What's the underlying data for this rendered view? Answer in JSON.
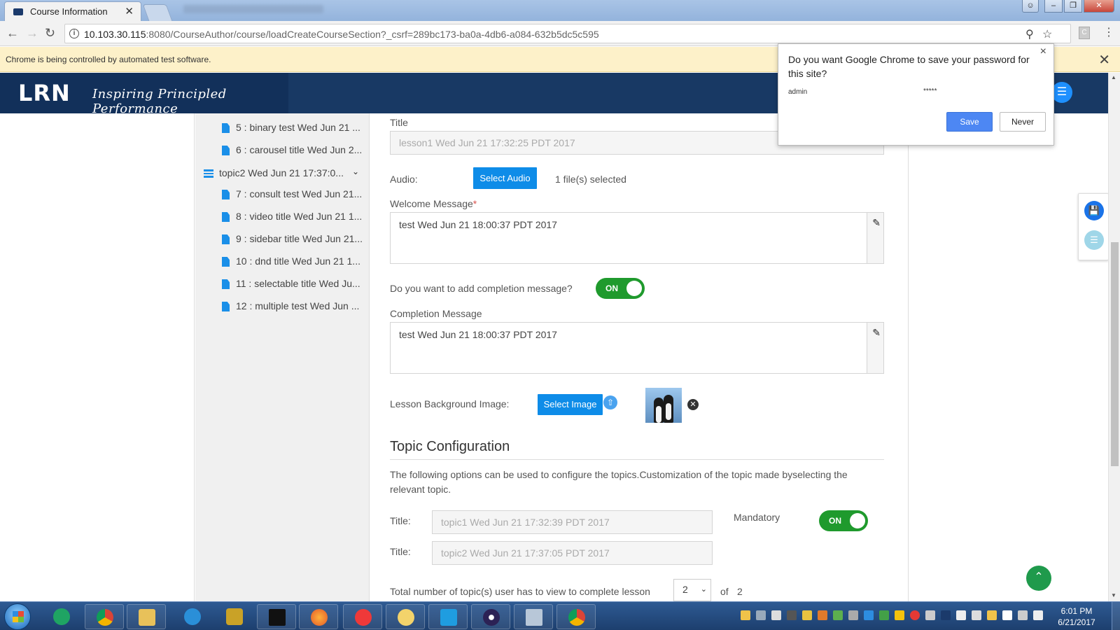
{
  "browser": {
    "tab_title": "Course Information",
    "tab_close": "✕",
    "url_host": "10.103.30.115",
    "url_rest": ":8080/CourseAuthor/course/loadCreateCourseSection?_csrf=289bc173-ba0a-4db6-a084-632b5dc5c595",
    "infobar_text": "Chrome is being controlled by automated test software.",
    "infobar_close": "✕"
  },
  "header": {
    "logo": "LRN",
    "tagline": "Inspiring Principled Performance"
  },
  "sidebar": {
    "items_top": [
      "5 : binary test Wed Jun 21 ...",
      "6 : carousel title Wed Jun 2..."
    ],
    "topic": "topic2 Wed Jun 21 17:37:0...",
    "items_bottom": [
      "7 : consult test Wed Jun 21...",
      "8 : video title Wed Jun 21 1...",
      "9 : sidebar title Wed Jun 21...",
      "10 : dnd title Wed Jun 21 1...",
      "11 : selectable title Wed Ju...",
      "12 : multiple test Wed Jun ..."
    ]
  },
  "form": {
    "title_label": "Title",
    "title_value": "lesson1 Wed Jun 21 17:32:25 PDT 2017",
    "audio_label": "Audio:",
    "select_audio": "Select Audio",
    "audio_status": "1 file(s) selected",
    "welcome_label": "Welcome Message",
    "required_mark": "*",
    "welcome_value": "test Wed Jun 21 18:00:37 PDT 2017",
    "completion_question": "Do you want to add completion message?",
    "completion_toggle": "ON",
    "completion_label": "Completion Message",
    "completion_value": "test Wed Jun 21 18:00:37 PDT 2017",
    "bg_label": "Lesson Background Image:",
    "select_image": "Select Image"
  },
  "topic_config": {
    "heading": "Topic Configuration",
    "description": "The following options can be used to configure the topics.Customization of the topic made byselecting the relevant topic.",
    "title_label": "Title:",
    "topic1_value": "topic1 Wed Jun 21 17:32:39 PDT 2017",
    "topic2_value": "topic2 Wed Jun 21 17:37:05 PDT 2017",
    "mandatory_label": "Mandatory",
    "mandatory_toggle": "ON",
    "total_label": "Total number of topic(s) user has to view to complete lesson",
    "total_selected": "2",
    "of_label": "of",
    "of_total": "2"
  },
  "password_popup": {
    "title": "Do you want Google Chrome to save your password for this site?",
    "username": "admin",
    "password": "*****",
    "save": "Save",
    "never": "Never",
    "close": "×"
  },
  "taskbar": {
    "time": "6:01 PM",
    "date": "6/21/2017"
  },
  "colors": {
    "header_bg": "#183964",
    "accent_blue": "#0e8ce8",
    "toggle_green": "#1f9a2d"
  }
}
